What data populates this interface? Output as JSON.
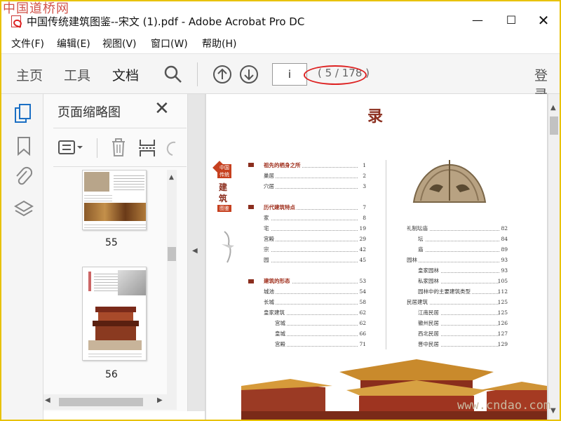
{
  "window": {
    "title": "中国传统建筑图鉴--宋文 (1).pdf - Adobe Acrobat Pro DC",
    "watermark_top": "中国道桥网",
    "watermark_bottom": "www.cndao.com"
  },
  "menu": [
    "文件(F)",
    "编辑(E)",
    "视图(V)",
    "窗口(W)",
    "帮助(H)"
  ],
  "toolbar": {
    "tabs": [
      "主页",
      "工具",
      "文档"
    ],
    "active_tab": "文档",
    "page_input": "i",
    "page_count": "( 5 / 178 )",
    "login": "登录"
  },
  "thumb_panel": {
    "title": "页面缩略图",
    "pages": [
      "55",
      "56"
    ]
  },
  "toc_page": {
    "heading": "录",
    "side_title": [
      "中国",
      "传统",
      "建",
      "筑",
      "图鉴"
    ],
    "left": [
      {
        "label": "祖先的栖身之所",
        "page": "1",
        "section": true
      },
      {
        "label": "巢居",
        "page": "2"
      },
      {
        "label": "穴居",
        "page": "3"
      },
      {
        "label": "历代建筑特点",
        "page": "7",
        "section": true
      },
      {
        "label": "家",
        "page": "8"
      },
      {
        "label": "宅",
        "page": "19"
      },
      {
        "label": "宫殿",
        "page": "29"
      },
      {
        "label": "宗",
        "page": "42"
      },
      {
        "label": "园",
        "page": "45"
      },
      {
        "label": "建筑的形态",
        "page": "53",
        "section": true
      },
      {
        "label": "城池",
        "page": "54"
      },
      {
        "label": "长城",
        "page": "58"
      },
      {
        "label": "皇家建筑",
        "page": "62"
      },
      {
        "label": "宫城",
        "page": "62",
        "indent": true
      },
      {
        "label": "皇城",
        "page": "66",
        "indent": true
      },
      {
        "label": "宫殿",
        "page": "71",
        "indent": true
      }
    ],
    "right": [
      {
        "label": "礼制坛庙",
        "page": "82"
      },
      {
        "label": "坛",
        "page": "84",
        "indent": true
      },
      {
        "label": "庙",
        "page": "89",
        "indent": true
      },
      {
        "label": "园林",
        "page": "93"
      },
      {
        "label": "皇家园林",
        "page": "93",
        "indent": true
      },
      {
        "label": "私家园林",
        "page": "105",
        "indent": true
      },
      {
        "label": "园林中的主要建筑类型",
        "page": "112",
        "indent": true
      },
      {
        "label": "民居建筑",
        "page": "125"
      },
      {
        "label": "江南民居",
        "page": "125",
        "indent": true
      },
      {
        "label": "徽州民居",
        "page": "126",
        "indent": true
      },
      {
        "label": "西北民居",
        "page": "127",
        "indent": true
      },
      {
        "label": "晋中民居",
        "page": "129",
        "indent": true
      }
    ]
  }
}
